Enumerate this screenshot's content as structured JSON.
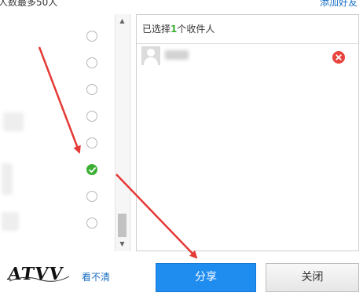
{
  "header": {
    "hint": "人数最多50人",
    "add_friend": "添加好友"
  },
  "friend_list": {
    "rows": [
      {
        "checked": false
      },
      {
        "checked": false
      },
      {
        "checked": false
      },
      {
        "checked": false
      },
      {
        "checked": false
      },
      {
        "checked": true
      },
      {
        "checked": false
      },
      {
        "checked": false
      }
    ]
  },
  "selected_panel": {
    "header_prefix": "已选择",
    "count": "1",
    "header_suffix": "个收件人"
  },
  "captcha": {
    "text": "ATVV",
    "refresh_link": "看不清"
  },
  "buttons": {
    "share": "分享",
    "close": "关闭"
  },
  "colors": {
    "accent_blue": "#1f8cf0",
    "check_green": "#3cb034",
    "remove_red": "#e8433c",
    "arrow_red": "#e53935"
  },
  "icons": {
    "checked_radio": "check-circle-icon",
    "remove": "close-circle-icon",
    "avatar": "default-avatar-icon"
  }
}
